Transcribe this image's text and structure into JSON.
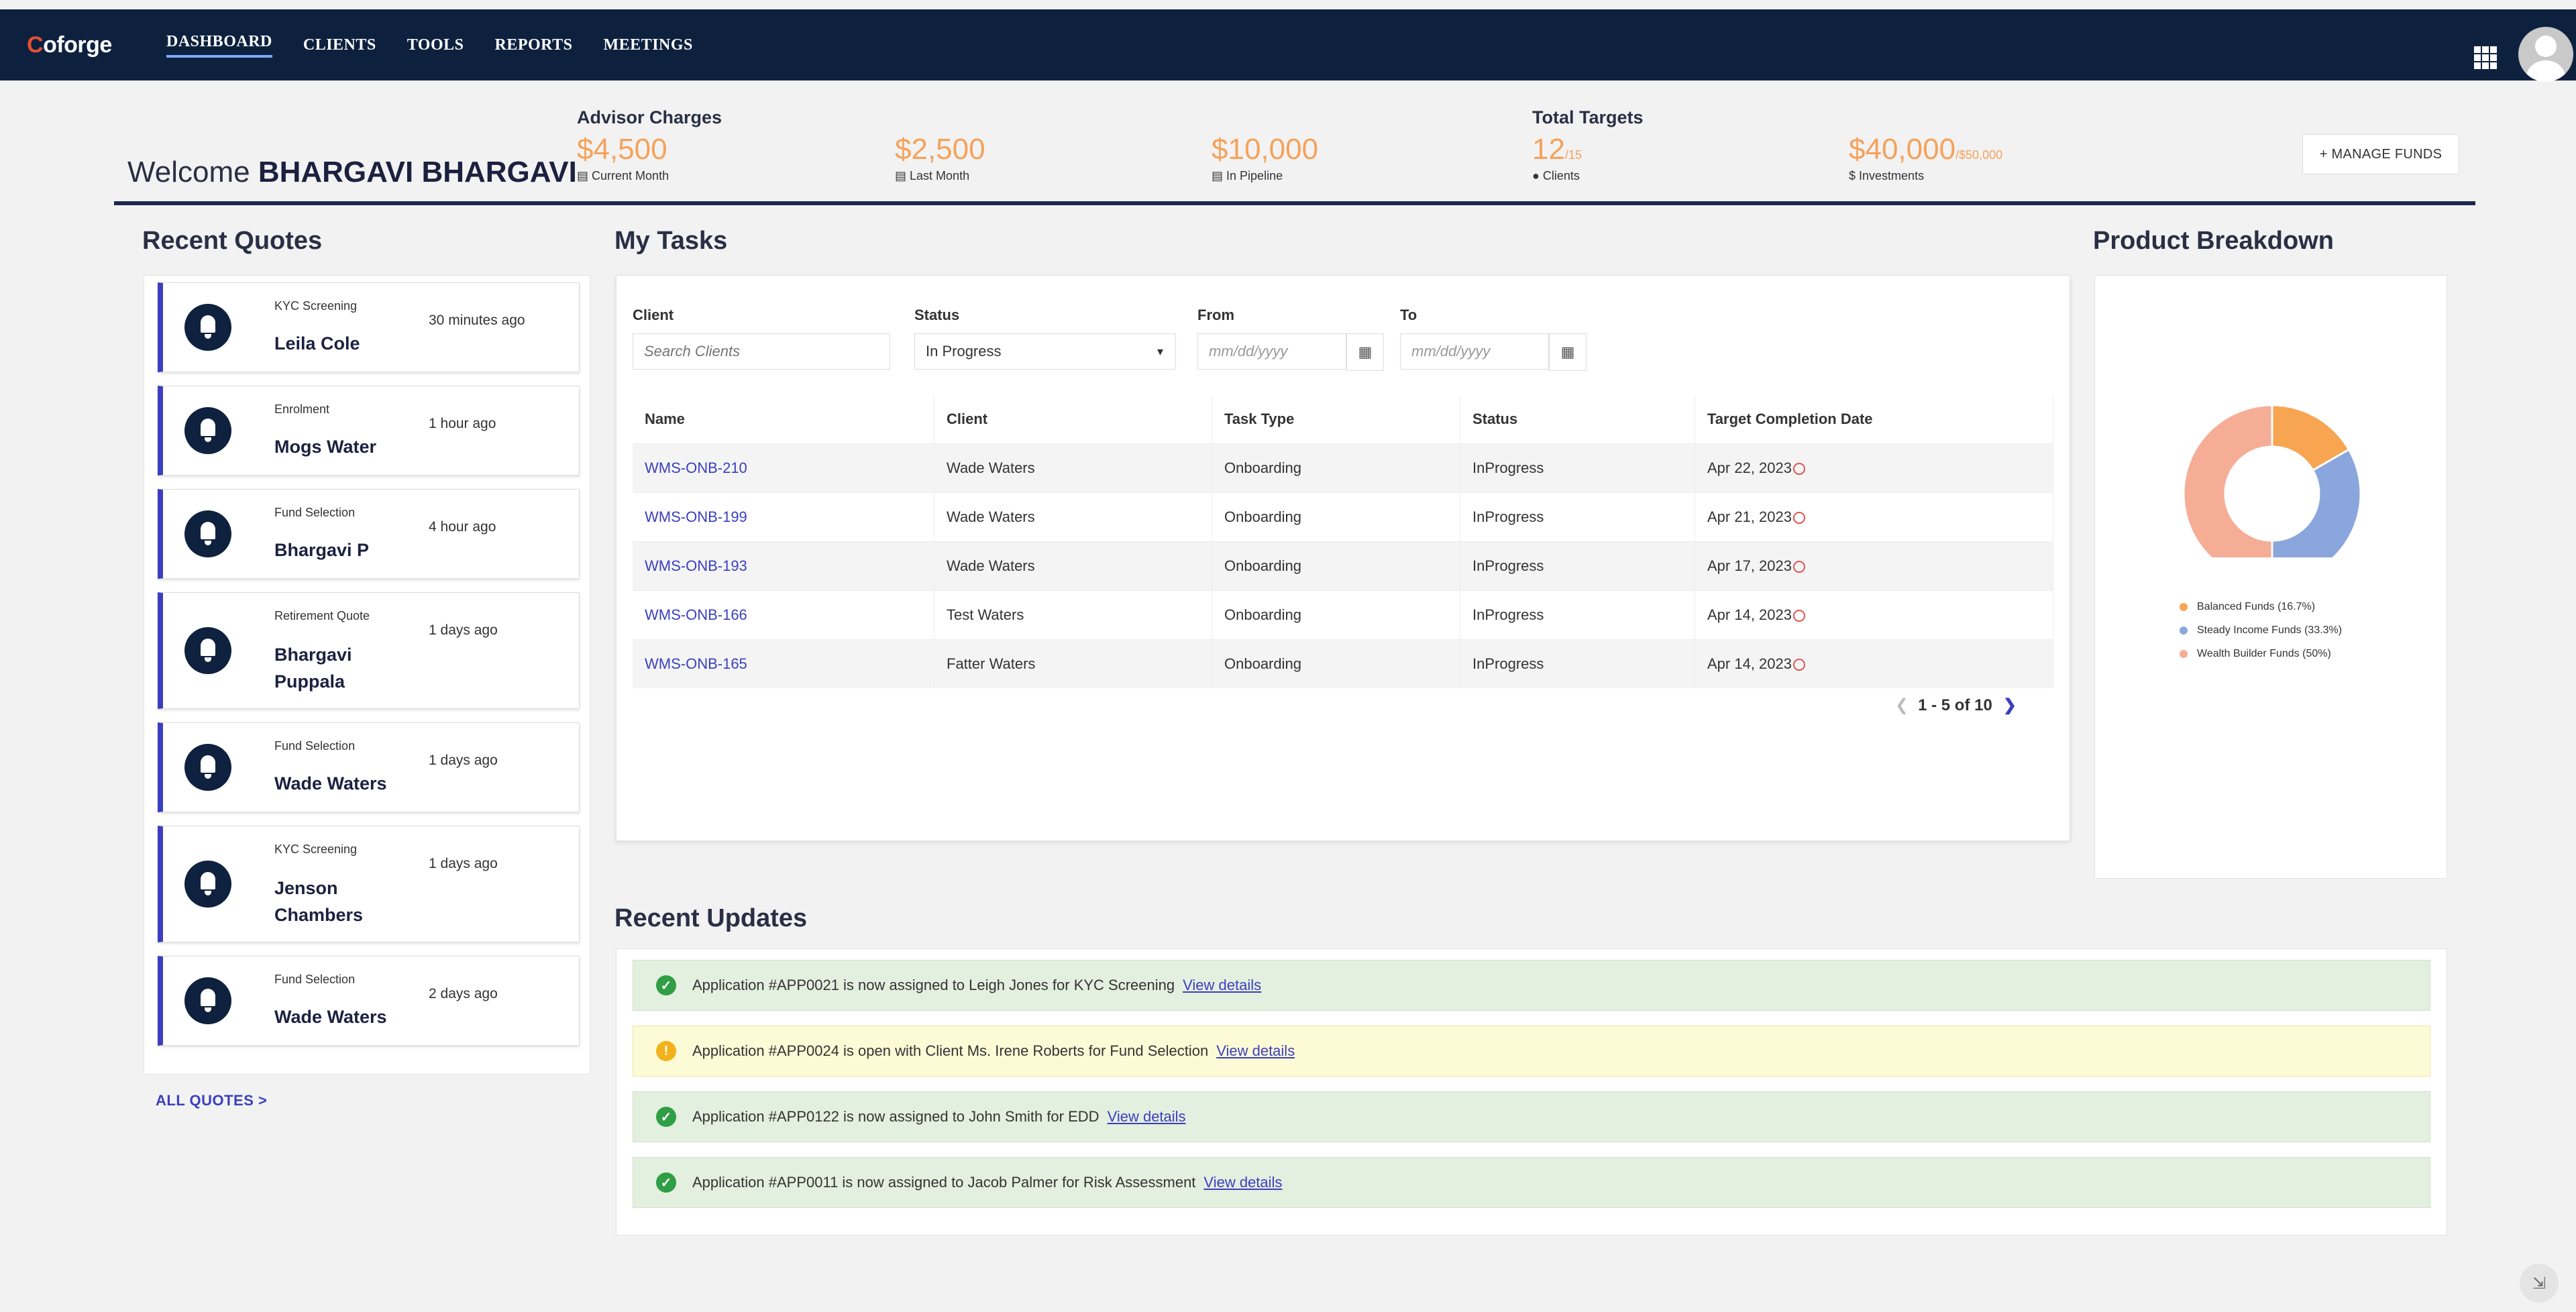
{
  "brand": {
    "logo_first": "C",
    "logo_rest": "oforge"
  },
  "nav": {
    "items": [
      "DASHBOARD",
      "CLIENTS",
      "TOOLS",
      "REPORTS",
      "MEETINGS"
    ],
    "active": 0
  },
  "welcome": {
    "prefix": "Welcome",
    "name": "BHARGAVI BHARGAVI"
  },
  "advisor_charges": {
    "title": "Advisor Charges",
    "current": {
      "value": "$4,500",
      "label": "Current Month"
    },
    "last": {
      "value": "$2,500",
      "label": "Last Month"
    },
    "pipeline": {
      "value": "$10,000",
      "label": "In Pipeline"
    }
  },
  "total_targets": {
    "title": "Total Targets",
    "clients": {
      "value": "12",
      "sub": "/15",
      "label": "Clients"
    },
    "investments": {
      "value": "$40,000",
      "sub": "/$50,000",
      "label": "Investments"
    }
  },
  "manage_funds": "+ MANAGE FUNDS",
  "recent_quotes": {
    "title": "Recent Quotes",
    "items": [
      {
        "type": "KYC Screening",
        "name": "Leila Cole",
        "time": "30 minutes ago"
      },
      {
        "type": "Enrolment",
        "name": "Mogs Water",
        "time": "1 hour ago"
      },
      {
        "type": "Fund Selection",
        "name": "Bhargavi P",
        "time": "4 hour ago"
      },
      {
        "type": "Retirement Quote",
        "name": "Bhargavi Puppala",
        "time": "1 days ago"
      },
      {
        "type": "Fund Selection",
        "name": "Wade Waters",
        "time": "1 days ago"
      },
      {
        "type": "KYC Screening",
        "name": "Jenson Chambers",
        "time": "1 days ago"
      },
      {
        "type": "Fund Selection",
        "name": "Wade Waters",
        "time": "2 days ago"
      }
    ],
    "all_link": "ALL QUOTES >"
  },
  "tasks": {
    "title": "My Tasks",
    "filters": {
      "client_label": "Client",
      "client_placeholder": "Search Clients",
      "status_label": "Status",
      "status_value": "In Progress",
      "from_label": "From",
      "from_placeholder": "mm/dd/yyyy",
      "to_label": "To",
      "to_placeholder": "mm/dd/yyyy"
    },
    "columns": [
      "Name",
      "Client",
      "Task Type",
      "Status",
      "Target Completion Date"
    ],
    "rows": [
      [
        "WMS-ONB-210",
        "Wade Waters",
        "Onboarding",
        "InProgress",
        "Apr 22, 2023"
      ],
      [
        "WMS-ONB-199",
        "Wade Waters",
        "Onboarding",
        "InProgress",
        "Apr 21, 2023"
      ],
      [
        "WMS-ONB-193",
        "Wade Waters",
        "Onboarding",
        "InProgress",
        "Apr 17, 2023"
      ],
      [
        "WMS-ONB-166",
        "Test Waters",
        "Onboarding",
        "InProgress",
        "Apr 14, 2023"
      ],
      [
        "WMS-ONB-165",
        "Fatter Waters",
        "Onboarding",
        "InProgress",
        "Apr 14, 2023"
      ]
    ],
    "pager": "1 - 5 of 10"
  },
  "product_breakdown": {
    "title": "Product Breakdown",
    "chart_data": {
      "type": "pie",
      "categories": [
        "Balanced Funds (16.7%)",
        "Steady Income Funds (33.3%)",
        "Wealth Builder Funds (50%)"
      ],
      "values": [
        16.7,
        33.3,
        50
      ],
      "colors": [
        "#f7a551",
        "#8aa6dc",
        "#f6ad96"
      ]
    }
  },
  "updates": {
    "title": "Recent Updates",
    "items": [
      {
        "kind": "ok",
        "text": "Application #APP0021 is now assigned to Leigh Jones for KYC Screening",
        "link": "View details"
      },
      {
        "kind": "info",
        "text": "Application #APP0024 is open with Client Ms. Irene Roberts for Fund Selection",
        "link": "View details"
      },
      {
        "kind": "ok",
        "text": "Application #APP0122 is now assigned to John Smith for EDD",
        "link": "View details"
      },
      {
        "kind": "ok",
        "text": "Application #APP0011 is now assigned to Jacob Palmer for Risk Assessment",
        "link": "View details"
      }
    ]
  }
}
